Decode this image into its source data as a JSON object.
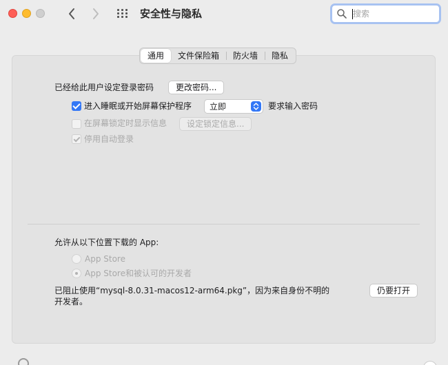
{
  "window": {
    "title": "安全性与隐私"
  },
  "search": {
    "placeholder": "搜索"
  },
  "tabs": [
    {
      "label": "通用",
      "active": true
    },
    {
      "label": "文件保险箱",
      "active": false
    },
    {
      "label": "防火墙",
      "active": false
    },
    {
      "label": "隐私",
      "active": false
    }
  ],
  "general": {
    "password_set_label": "已经给此用户设定登录密码",
    "change_password_button": "更改密码...",
    "sleep_checkbox": {
      "label": "进入睡眠或开始屏幕保护程序",
      "checked": true
    },
    "sleep_select_value": "立即",
    "require_password_label": "要求输入密码",
    "lock_message_checkbox": {
      "label": "在屏幕锁定时显示信息",
      "checked": false,
      "disabled": true
    },
    "set_lock_message_button": "设定锁定信息...",
    "disable_autologin_checkbox": {
      "label": "停用自动登录",
      "checked": true,
      "disabled": true
    }
  },
  "downloads": {
    "heading": "允许从以下位置下载的 App:",
    "options": [
      {
        "label": "App Store",
        "selected": false
      },
      {
        "label": "App Store和被认可的开发者",
        "selected": true
      }
    ],
    "blocked_message_line1": "已阻止使用“mysql-8.0.31-macos12-arm64.pkg”，因为来自身份不明的",
    "blocked_message_line2": "开发者。",
    "open_anyway_button": "仍要打开"
  },
  "colors": {
    "accent": "#3478f6",
    "close": "#fe5f57",
    "minimize": "#febc2e",
    "search_focus": "#a7c2f1"
  }
}
